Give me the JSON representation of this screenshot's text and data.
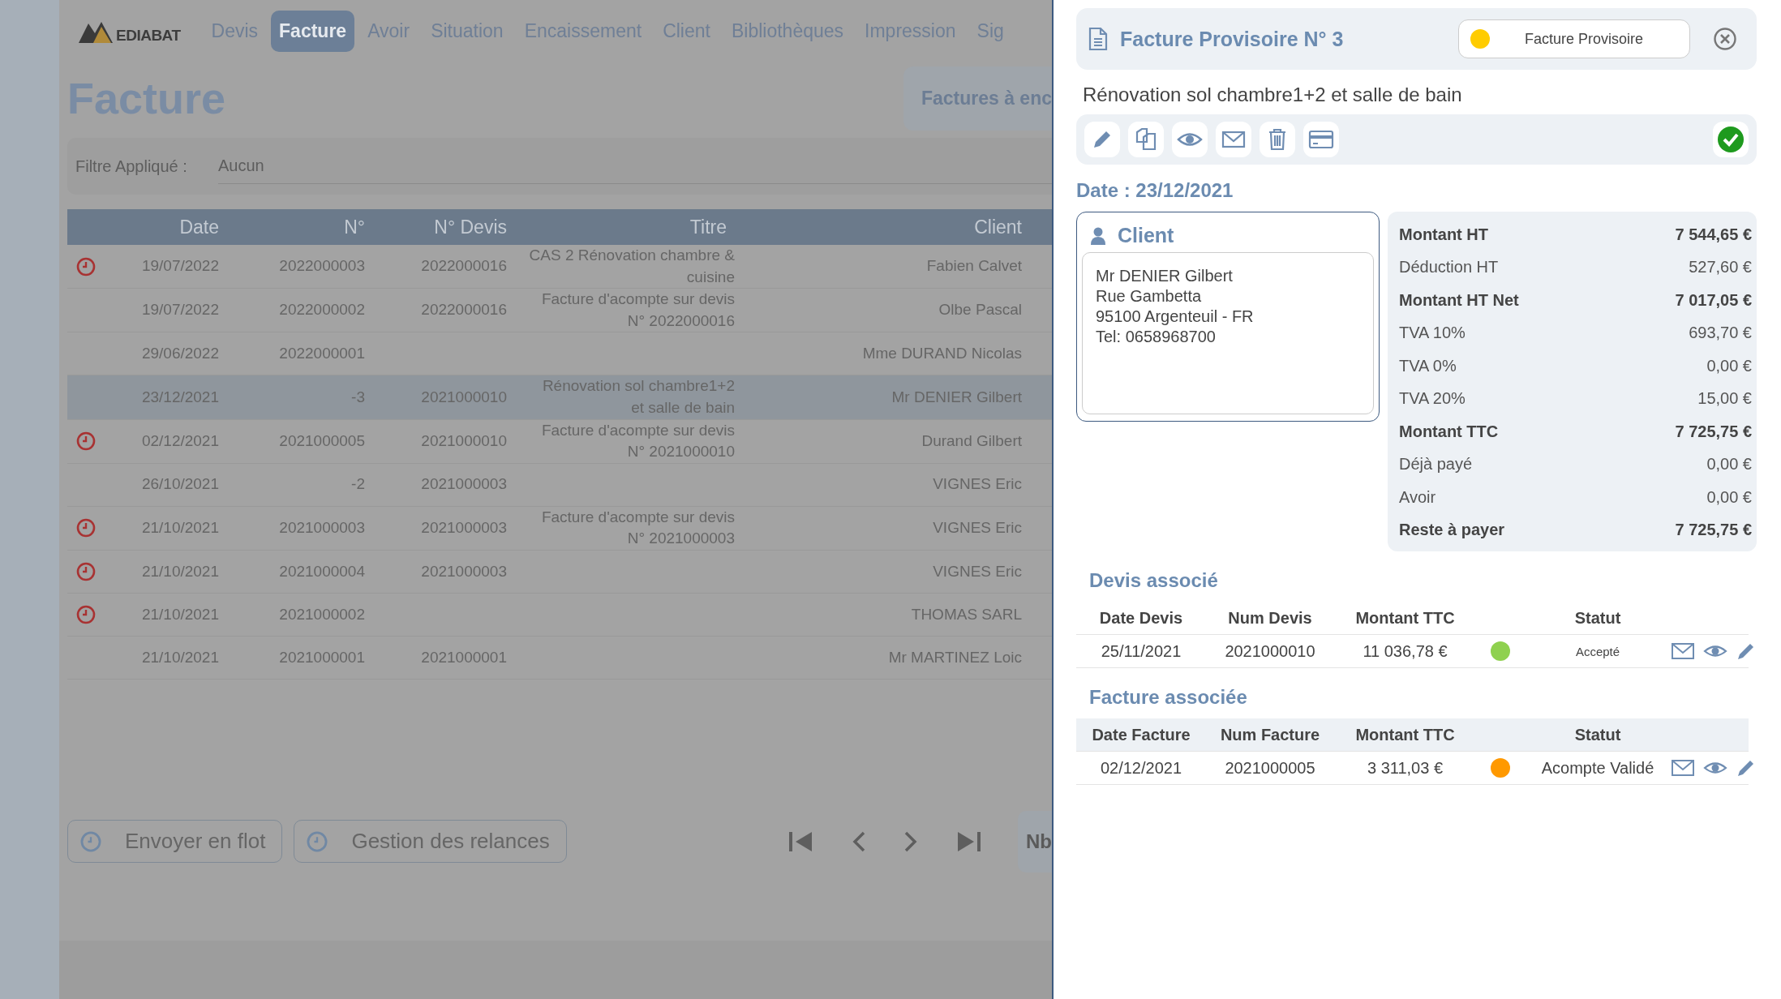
{
  "nav": {
    "logo": "EDIABAT",
    "items": [
      {
        "label": "Devis",
        "selected": false
      },
      {
        "label": "Facture",
        "selected": true
      },
      {
        "label": "Avoir",
        "selected": false
      },
      {
        "label": "Situation",
        "selected": false
      },
      {
        "label": "Encaissement",
        "selected": false
      },
      {
        "label": "Client",
        "selected": false
      },
      {
        "label": "Bibliothèques",
        "selected": false
      },
      {
        "label": "Impression",
        "selected": false
      },
      {
        "label": "Sig",
        "selected": false
      }
    ]
  },
  "page_title": "Facture",
  "side_button": "Factures à enc",
  "filter": {
    "label": "Filtre Appliqué :",
    "value": "Aucun"
  },
  "table": {
    "columns": [
      "Date",
      "N°",
      "N° Devis",
      "Titre",
      "Client"
    ],
    "rows": [
      {
        "reminder": true,
        "selected": false,
        "date": "19/07/2022",
        "number": "2022000003",
        "devis": "2022000016",
        "title": "CAS 2 Rénovation chambre & cuisine",
        "client": "Fabien Calvet"
      },
      {
        "reminder": false,
        "selected": false,
        "date": "19/07/2022",
        "number": "2022000002",
        "devis": "2022000016",
        "title": "Facture d'acompte sur devis N° 2022000016",
        "client": "Olbe Pascal"
      },
      {
        "reminder": false,
        "selected": false,
        "date": "29/06/2022",
        "number": "2022000001",
        "devis": "",
        "title": "",
        "client": "Mme DURAND Nicolas"
      },
      {
        "reminder": false,
        "selected": true,
        "date": "23/12/2021",
        "number": "-3",
        "devis": "2021000010",
        "title": "Rénovation sol chambre1+2 et salle de bain",
        "client": "Mr DENIER Gilbert"
      },
      {
        "reminder": true,
        "selected": false,
        "date": "02/12/2021",
        "number": "2021000005",
        "devis": "2021000010",
        "title": "Facture d'acompte sur devis N° 2021000010",
        "client": "Durand Gilbert"
      },
      {
        "reminder": false,
        "selected": false,
        "date": "26/10/2021",
        "number": "-2",
        "devis": "2021000003",
        "title": "",
        "client": "VIGNES Eric"
      },
      {
        "reminder": true,
        "selected": false,
        "date": "21/10/2021",
        "number": "2021000003",
        "devis": "2021000003",
        "title": "Facture d'acompte sur devis N° 2021000003",
        "client": "VIGNES Eric"
      },
      {
        "reminder": true,
        "selected": false,
        "date": "21/10/2021",
        "number": "2021000004",
        "devis": "2021000003",
        "title": "",
        "client": "VIGNES Eric"
      },
      {
        "reminder": true,
        "selected": false,
        "date": "21/10/2021",
        "number": "2021000002",
        "devis": "",
        "title": "",
        "client": "THOMAS SARL"
      },
      {
        "reminder": false,
        "selected": false,
        "date": "21/10/2021",
        "number": "2021000001",
        "devis": "2021000001",
        "title": "",
        "client": "Mr MARTINEZ Loic"
      }
    ]
  },
  "bottom_buttons": [
    "Envoyer en flot",
    "Gestion des relances"
  ],
  "page_size_label": "Nb",
  "drawer": {
    "title": "Facture Provisoire N° 3",
    "status": {
      "label": "Facture Provisoire",
      "color": "#ffcc00"
    },
    "subtitle": "Rénovation sol chambre1+2 et salle de bain",
    "date": "Date : 23/12/2021",
    "client": {
      "heading": "Client",
      "lines": [
        "Mr DENIER Gilbert",
        "Rue Gambetta",
        "95100 Argenteuil - FR",
        "Tel: 0658968700"
      ]
    },
    "totals": [
      {
        "label": "Montant HT",
        "value": "7 544,65 €",
        "bold": true
      },
      {
        "label": "Déduction HT",
        "value": "527,60 €",
        "bold": false
      },
      {
        "label": "Montant HT Net",
        "value": "7 017,05 €",
        "bold": true
      },
      {
        "label": "TVA 10%",
        "value": "693,70 €",
        "bold": false
      },
      {
        "label": "TVA 0%",
        "value": "0,00 €",
        "bold": false
      },
      {
        "label": "TVA 20%",
        "value": "15,00 €",
        "bold": false
      },
      {
        "label": "Montant TTC",
        "value": "7 725,75 €",
        "bold": true
      },
      {
        "label": "Déjà payé",
        "value": "0,00 €",
        "bold": false
      },
      {
        "label": "Avoir",
        "value": "0,00 €",
        "bold": false
      },
      {
        "label": "Reste à payer",
        "value": "7 725,75 €",
        "bold": true
      }
    ],
    "sections": [
      {
        "title": "Devis associé",
        "columns": [
          "Date Devis",
          "Num Devis",
          "Montant TTC",
          "Statut"
        ],
        "rows": [
          {
            "date": "25/11/2021",
            "num": "2021000010",
            "amount": "11 036,78 €",
            "status": "Accepté",
            "color": "#8fd14f"
          }
        ]
      },
      {
        "title": "Facture associée",
        "columns": [
          "Date Facture",
          "Num Facture",
          "Montant TTC",
          "Statut"
        ],
        "rows": [
          {
            "date": "02/12/2021",
            "num": "2021000005",
            "amount": "3 311,03 €",
            "status": "Acompte Validé",
            "color": "#ff9900"
          }
        ]
      }
    ]
  }
}
